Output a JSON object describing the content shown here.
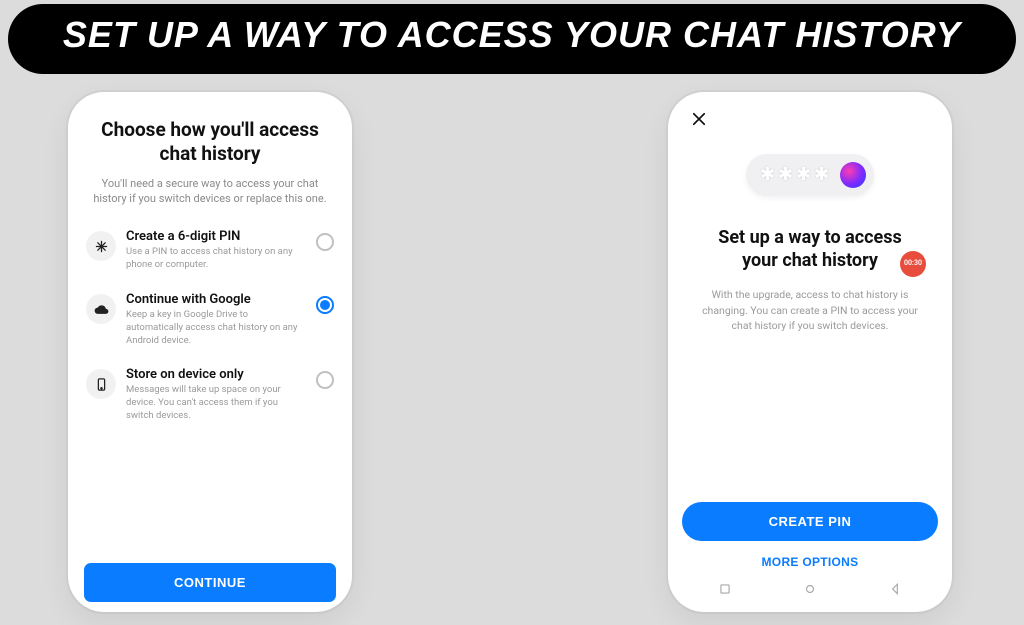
{
  "banner": {
    "title": "SET UP A WAY TO ACCESS YOUR CHAT HISTORY"
  },
  "left": {
    "title": "Choose how you'll access chat history",
    "subtitle": "You'll need a secure way to access your chat history if you switch devices or replace this one.",
    "options": [
      {
        "title": "Create a 6-digit PIN",
        "desc": "Use a PIN to access chat history on any phone or computer.",
        "selected": false,
        "icon": "asterisk"
      },
      {
        "title": "Continue with Google",
        "desc": "Keep a key in Google Drive to automatically access chat history on any Android device.",
        "selected": true,
        "icon": "cloud"
      },
      {
        "title": "Store on device only",
        "desc": "Messages will take up space on your device. You can't access them if you switch devices.",
        "selected": false,
        "icon": "phone"
      }
    ],
    "continue_label": "CONTINUE"
  },
  "right": {
    "title": "Set up a way to access your chat history",
    "badge": "00:30",
    "subtitle": "With the upgrade, access to chat history is changing. You can create a PIN to access your chat history if you switch devices.",
    "create_pin_label": "CREATE PIN",
    "more_options_label": "MORE OPTIONS"
  }
}
